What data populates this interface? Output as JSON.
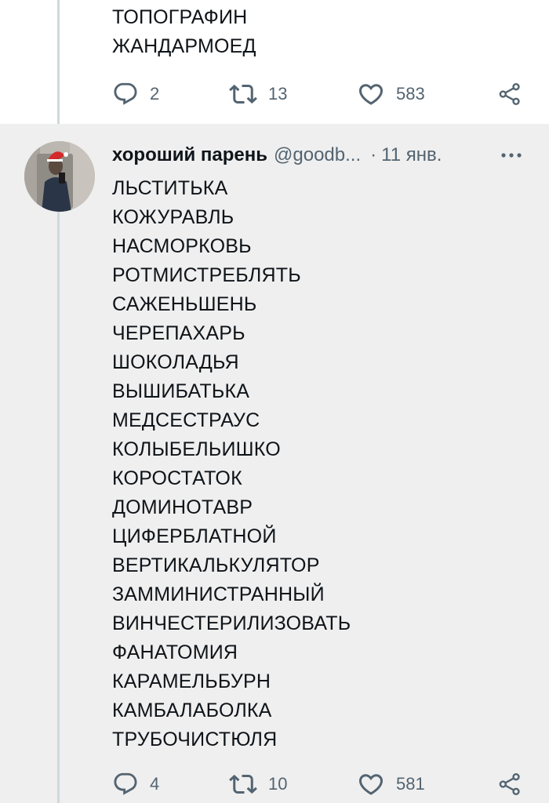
{
  "previous_tweet": {
    "lines": [
      "ТОПОГРАФИН",
      "ЖАНДАРМОЕД"
    ],
    "actions": {
      "replies": "2",
      "retweets": "13",
      "likes": "583"
    }
  },
  "tweet": {
    "display_name": "хороший парень",
    "handle": "@goodb...",
    "separator": "·",
    "date": "11 янв.",
    "lines": [
      "ЛЬСТИТЬКА",
      "КОЖУРАВЛЬ",
      "НАСМОРКОВЬ",
      "РОТМИСТРЕБЛЯТЬ",
      "САЖЕНЬШЕНЬ",
      "ЧЕРЕПАХАРЬ",
      "ШОКОЛАДЬЯ",
      "ВЫШИБАТЬКА",
      "МЕДСЕСТРАУС",
      "КОЛЫБЕЛЬИШКО",
      "КОРОСТАТОК",
      "ДОМИНОТАВР",
      "ЦИФЕРБЛАТНОЙ",
      "ВЕРТИКАЛЬКУЛЯТОР",
      "ЗАММИНИСТРАННЫЙ",
      "ВИНЧЕСТЕРИЛИЗОВАТЬ",
      "ФАНАТОМИЯ",
      "КАРАМЕЛЬБУРН",
      "КАМБАЛАБОЛКА",
      "ТРУБОЧИСТЮЛЯ"
    ],
    "actions": {
      "replies": "4",
      "retweets": "10",
      "likes": "581"
    }
  },
  "icons": {
    "reply": "reply-icon",
    "retweet": "retweet-icon",
    "like": "heart-icon",
    "share": "share-icon",
    "more": "more-icon"
  },
  "colors": {
    "text": "#0f1419",
    "secondary": "#536471",
    "highlight_background": "#efefef",
    "thread_line": "#cfd9de"
  }
}
